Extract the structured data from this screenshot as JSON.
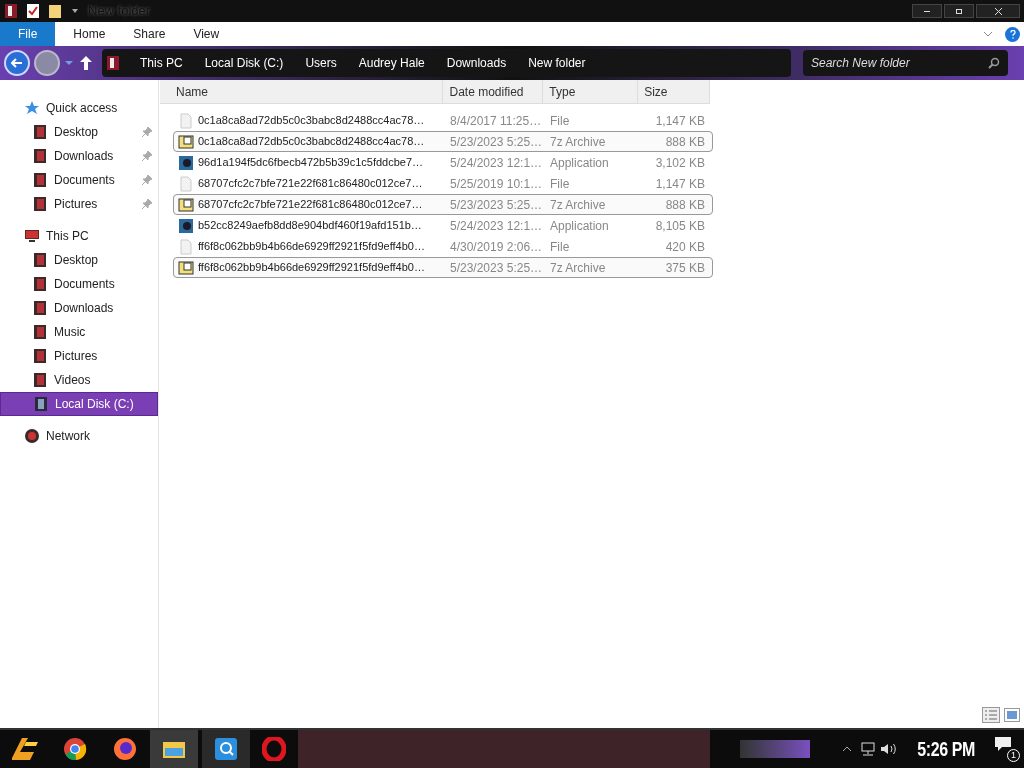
{
  "window": {
    "title": "New folder"
  },
  "ribbon_tabs": [
    {
      "label": "File",
      "selected": true
    },
    {
      "label": "Home",
      "selected": false
    },
    {
      "label": "Share",
      "selected": false
    },
    {
      "label": "View",
      "selected": false
    }
  ],
  "breadcrumb": [
    "This PC",
    "Local Disk (C:)",
    "Users",
    "Audrey Hale",
    "Downloads",
    "New folder"
  ],
  "search": {
    "placeholder": "Search New folder"
  },
  "sidebar": {
    "items": [
      {
        "label": "Quick access",
        "kind": "star",
        "selected": false,
        "children": [
          {
            "label": "Desktop",
            "kind": "folder",
            "pinned": true,
            "selected": false
          },
          {
            "label": "Downloads",
            "kind": "folder",
            "pinned": true,
            "selected": false
          },
          {
            "label": "Documents",
            "kind": "folder",
            "pinned": true,
            "selected": false
          },
          {
            "label": "Pictures",
            "kind": "folder",
            "pinned": true,
            "selected": false
          }
        ]
      },
      {
        "label": "This PC",
        "kind": "pc",
        "selected": false,
        "children": [
          {
            "label": "Desktop",
            "kind": "folder",
            "pinned": false,
            "selected": false
          },
          {
            "label": "Documents",
            "kind": "folder",
            "pinned": false,
            "selected": false
          },
          {
            "label": "Downloads",
            "kind": "folder",
            "pinned": false,
            "selected": false
          },
          {
            "label": "Music",
            "kind": "folder",
            "pinned": false,
            "selected": false
          },
          {
            "label": "Pictures",
            "kind": "folder",
            "pinned": false,
            "selected": false
          },
          {
            "label": "Videos",
            "kind": "folder",
            "pinned": false,
            "selected": false
          },
          {
            "label": "Local Disk (C:)",
            "kind": "drive",
            "pinned": false,
            "selected": true
          }
        ]
      },
      {
        "label": "Network",
        "kind": "network",
        "selected": false
      }
    ]
  },
  "table": {
    "columns": [
      "Name",
      "Date modified",
      "Type",
      "Size"
    ],
    "rows": [
      {
        "kind": "file",
        "selected": false,
        "cells": [
          "0c1a8ca8ad72db5c0c3babc8d2488cc4ac78…",
          "8/4/2017 11:25…",
          "File",
          "1,147 KB"
        ]
      },
      {
        "kind": "archive",
        "selected": true,
        "cells": [
          "0c1a8ca8ad72db5c0c3babc8d2488cc4ac78…",
          "5/23/2023 5:25…",
          "7z Archive",
          "888 KB"
        ]
      },
      {
        "kind": "application",
        "selected": false,
        "cells": [
          "96d1a194f5dc6fbecb472b5b39c1c5fddcbe7…",
          "5/24/2023 12:1…",
          "Application",
          "3,102 KB"
        ]
      },
      {
        "kind": "file",
        "selected": false,
        "cells": [
          "68707cfc2c7bfe721e22f681c86480c012ce7…",
          "5/25/2019 10:1…",
          "File",
          "1,147 KB"
        ]
      },
      {
        "kind": "archive",
        "selected": true,
        "cells": [
          "68707cfc2c7bfe721e22f681c86480c012ce7…",
          "5/23/2023 5:25…",
          "7z Archive",
          "888 KB"
        ]
      },
      {
        "kind": "application",
        "selected": false,
        "cells": [
          "b52cc8249aefb8dd8e904bdf460f19afd151b…",
          "5/24/2023 12:1…",
          "Application",
          "8,105 KB"
        ]
      },
      {
        "kind": "file",
        "selected": false,
        "cells": [
          "ff6f8c062bb9b4b66de6929ff2921f5fd9eff4b0…",
          "4/30/2019 2:06…",
          "File",
          "420 KB"
        ]
      },
      {
        "kind": "archive",
        "selected": true,
        "cells": [
          "ff6f8c062bb9b4b66de6929ff2921f5fd9eff4b0…",
          "5/23/2023 5:25…",
          "7z Archive",
          "375 KB"
        ]
      }
    ]
  },
  "taskbar": {
    "clock": "5:26 PM",
    "notification_count": "1"
  }
}
